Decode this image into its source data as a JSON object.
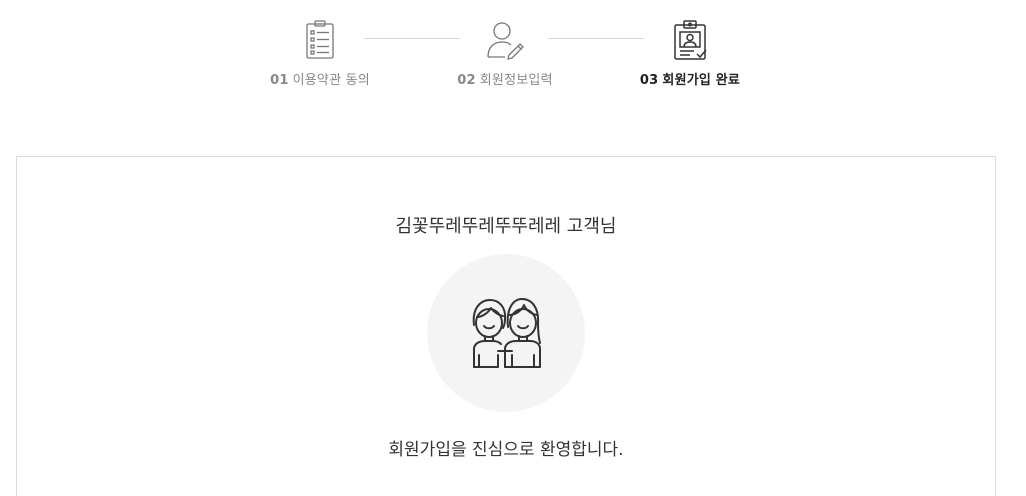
{
  "steps": [
    {
      "number": "01",
      "label": "이용약관 동의",
      "icon": "clipboard-checklist-icon",
      "active": false
    },
    {
      "number": "02",
      "label": "회원정보입력",
      "icon": "user-edit-icon",
      "active": false
    },
    {
      "number": "03",
      "label": "회원가입 완료",
      "icon": "id-card-approved-icon",
      "active": true
    }
  ],
  "panel": {
    "greeting": "김꽃뚜레뚜레뚜뚜레레 고객님",
    "illustration_icon": "two-people-icon",
    "welcome_message": "회원가입을 진심으로 환영합니다."
  },
  "colors": {
    "active_text": "#222222",
    "inactive_text": "#888888",
    "border": "#dcdcdc",
    "circle_bg": "#f4f4f4",
    "icon_stroke": "#333333"
  }
}
